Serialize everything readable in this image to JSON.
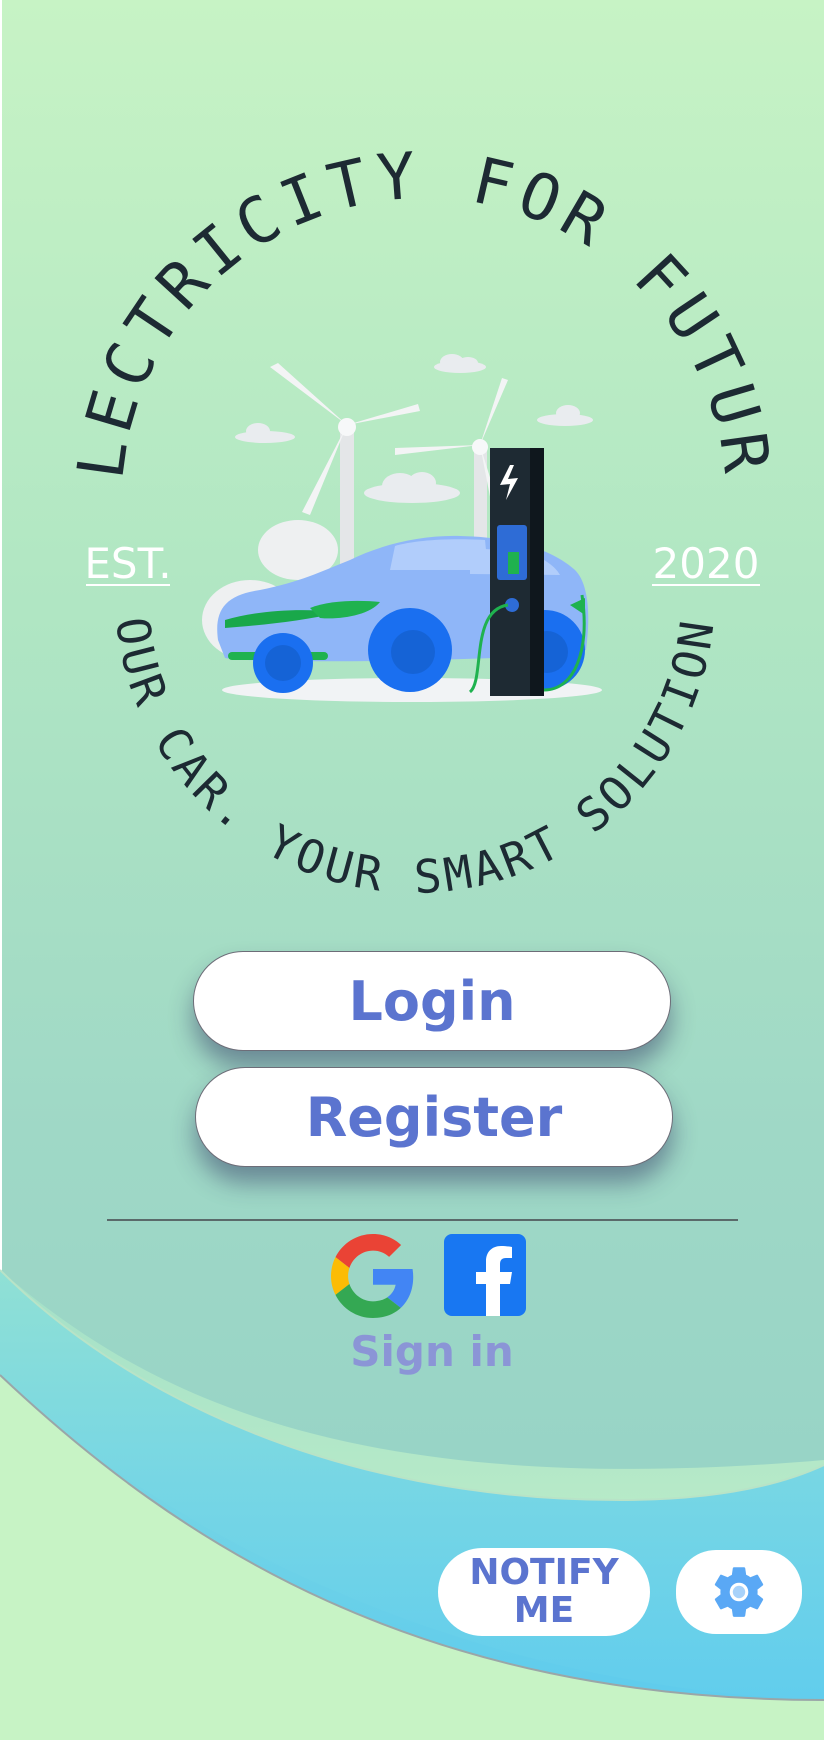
{
  "logo": {
    "top_text": "ELECTRICITY FOR FUTURE",
    "bottom_text": "YOUR CAR. YOUR SMART SOLUTION.",
    "est_label": "EST.",
    "year_label": "2020"
  },
  "buttons": {
    "login_label": "Login",
    "register_label": "Register",
    "notify_label": "NOTIFY\nME"
  },
  "social": {
    "sign_in_label": "Sign in",
    "providers": [
      "google-icon",
      "facebook-icon"
    ]
  },
  "icons": {
    "settings": "gear-icon"
  },
  "colors": {
    "accent": "#5b74cf",
    "sign_in": "#8b95d6",
    "facebook": "#1877f2",
    "gear": "#5aa8f5"
  }
}
